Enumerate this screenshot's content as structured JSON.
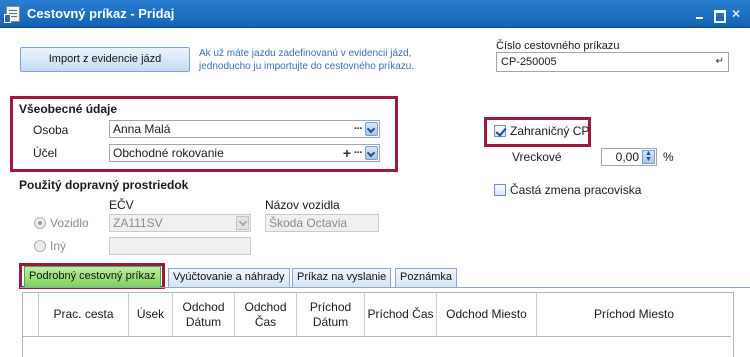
{
  "window": {
    "title": "Cestovný príkaz - Pridaj",
    "controls": [
      "minimize",
      "maximize",
      "close"
    ]
  },
  "import": {
    "button_label": "Import z evidencie jázd",
    "hint": "Ak už máte jazdu zadefinovanú v evidencii jázd, jednoducho ju importujte do cestovného príkazu."
  },
  "cislo": {
    "label": "Číslo cestovného príkazu",
    "value": "CP-250005"
  },
  "vseobecne": {
    "title": "Všeobecné údaje",
    "osoba_label": "Osoba",
    "osoba_value": "Anna Malá",
    "ucel_label": "Účel",
    "ucel_value": "Obchodné rokovanie",
    "dots": "···",
    "plus": "+"
  },
  "zahranicny": {
    "label": "Zahraničný CP",
    "checked": true
  },
  "vreckove": {
    "label": "Vreckové",
    "value": "0,00",
    "unit": "%"
  },
  "casta": {
    "label": "Častá zmena pracoviska",
    "checked": false
  },
  "doprava": {
    "title": "Použitý dopravný prostriedok",
    "ecv_header": "EČV",
    "nazov_header": "Názov vozidla",
    "vozidlo_label": "Vozidlo",
    "ecv_value": "ZA111SV",
    "nazov_value": "Škoda Octavia",
    "iny_label": "Iný",
    "iny_value": ""
  },
  "tabs": [
    {
      "label": "Podrobný cestovný príkaz",
      "active": true
    },
    {
      "label": "Vyúčtovanie a náhrady",
      "active": false
    },
    {
      "label": "Príkaz na vyslanie",
      "active": false
    },
    {
      "label": "Poznámka",
      "active": false
    }
  ],
  "grid": {
    "columns": [
      "Prac. cesta",
      "Úsek",
      "Odchod Dátum",
      "Odchod Čas",
      "Príchod Dátum",
      "Príchod Čas",
      "Odchod Miesto",
      "Príchod Miesto"
    ]
  },
  "colors": {
    "titlebar": "#1f74c6",
    "highlight_box": "#9b1b3a",
    "active_tab": "#7dd356",
    "hint_text": "#3b6fb3"
  }
}
